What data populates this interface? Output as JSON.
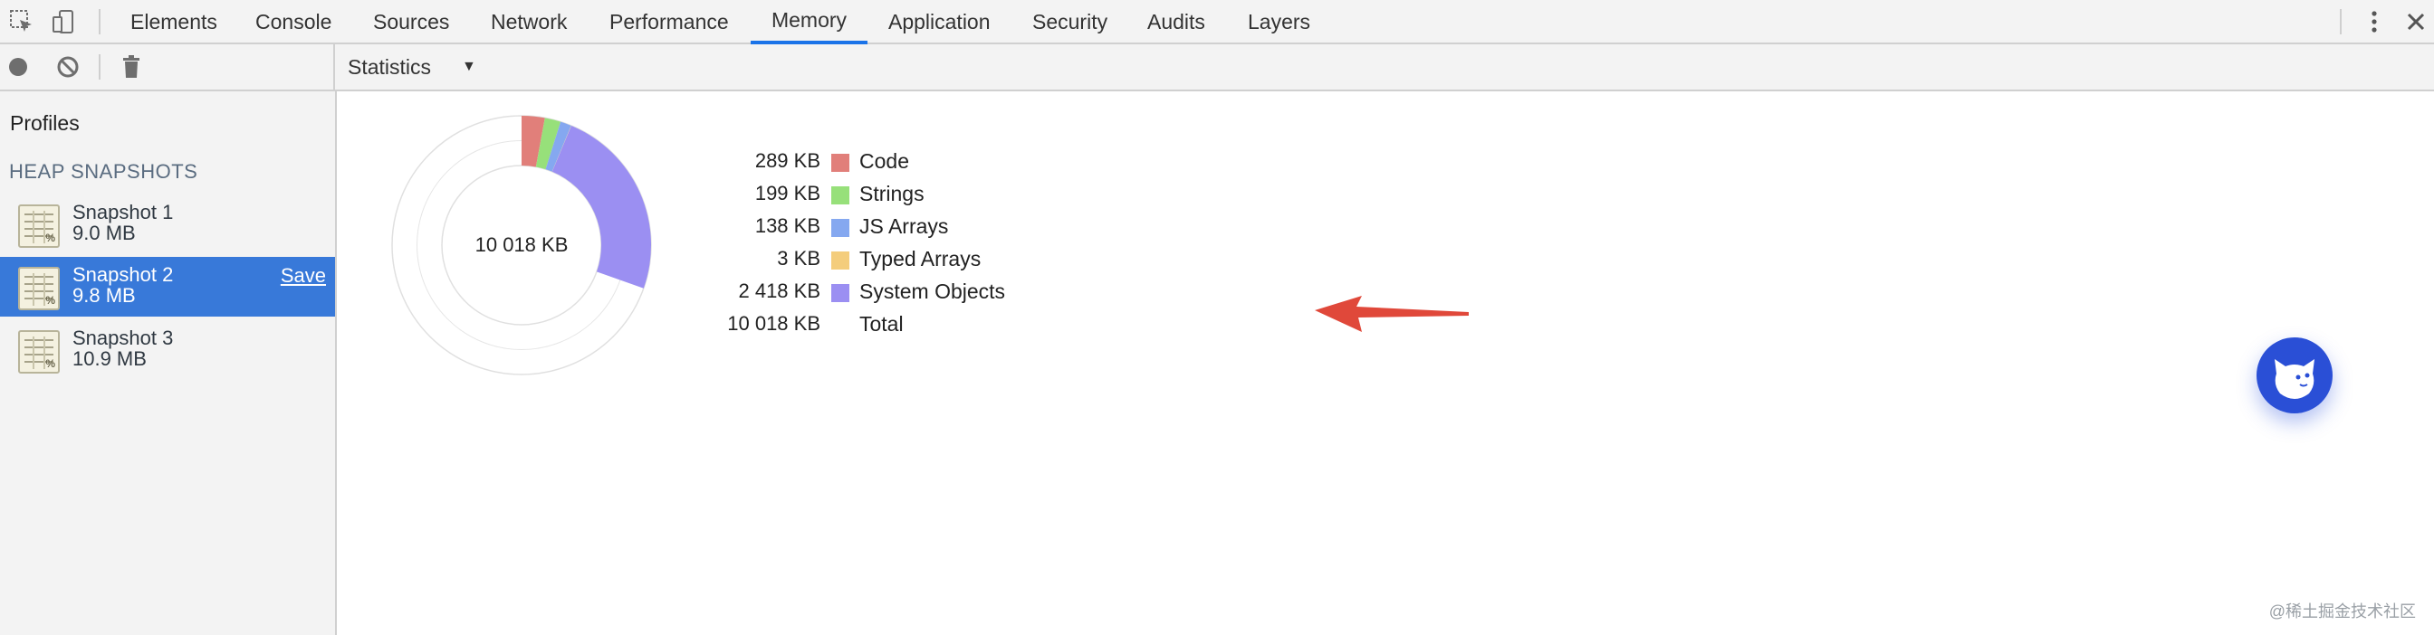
{
  "tabs": [
    {
      "label": "Elements"
    },
    {
      "label": "Console"
    },
    {
      "label": "Sources"
    },
    {
      "label": "Network"
    },
    {
      "label": "Performance"
    },
    {
      "label": "Memory"
    },
    {
      "label": "Application"
    },
    {
      "label": "Security"
    },
    {
      "label": "Audits"
    },
    {
      "label": "Layers"
    }
  ],
  "active_tab": "Memory",
  "toolbar": {
    "view_select": "Statistics"
  },
  "sidebar": {
    "title": "Profiles",
    "section": "HEAP SNAPSHOTS",
    "snapshots": [
      {
        "name": "Snapshot 1",
        "size": "9.0 MB",
        "icon_pct": "%"
      },
      {
        "name": "Snapshot 2",
        "size": "9.8 MB",
        "icon_pct": "%",
        "save_label": "Save"
      },
      {
        "name": "Snapshot 3",
        "size": "10.9 MB",
        "icon_pct": "%"
      }
    ],
    "selected_index": 1
  },
  "statistics": {
    "total_label": "10 018 KB",
    "items": [
      {
        "value": "289 KB",
        "name": "Code",
        "kb": 289,
        "color": "#e17f7a"
      },
      {
        "value": "199 KB",
        "name": "Strings",
        "kb": 199,
        "color": "#97e07a"
      },
      {
        "value": "138 KB",
        "name": "JS Arrays",
        "kb": 138,
        "color": "#85a8f0"
      },
      {
        "value": "3 KB",
        "name": "Typed Arrays",
        "kb": 3,
        "color": "#f4cd7c"
      },
      {
        "value": "2 418 KB",
        "name": "System Objects",
        "kb": 2418,
        "color": "#9b8ff2"
      },
      {
        "value": "10 018 KB",
        "name": "Total",
        "kb": 10018,
        "color": ""
      }
    ],
    "total_kb": 10018
  },
  "colors": {
    "accent": "#1a73e8",
    "selected_row": "#3879d9",
    "arrow": "#e0483a"
  },
  "watermark": "@稀土掘金技术社区"
}
